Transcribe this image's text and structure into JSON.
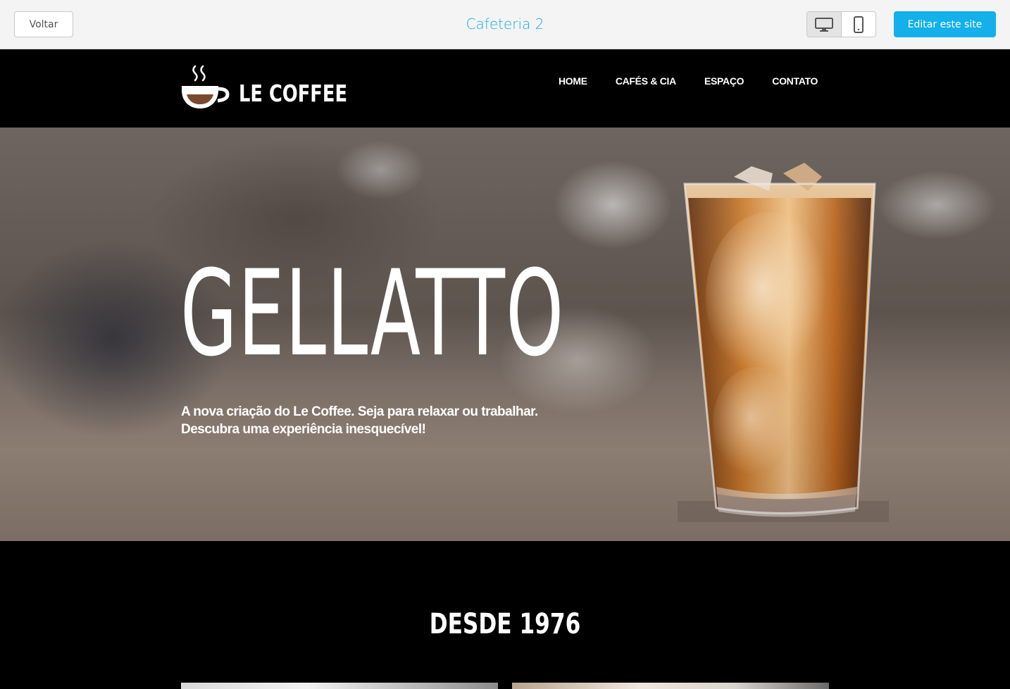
{
  "editor": {
    "back_label": "Voltar",
    "site_title": "Cafeteria 2",
    "devices": [
      {
        "name": "desktop-icon",
        "active": true
      },
      {
        "name": "mobile-icon",
        "active": false
      }
    ],
    "edit_label": "Editar este site",
    "accent_color": "#13b0ea"
  },
  "site": {
    "logo_text": "LE COFFEE",
    "nav": [
      "HOME",
      "CAFÉS & CIA",
      "ESPAÇO",
      "CONTATO"
    ]
  },
  "hero": {
    "title": "GELLATTO",
    "text_line1": "A nova criação do Le Coffee. Seja para relaxar ou trabalhar.",
    "text_line2": "Descubra uma experiência inesquecível!"
  },
  "section": {
    "title": "DESDE 1976"
  }
}
